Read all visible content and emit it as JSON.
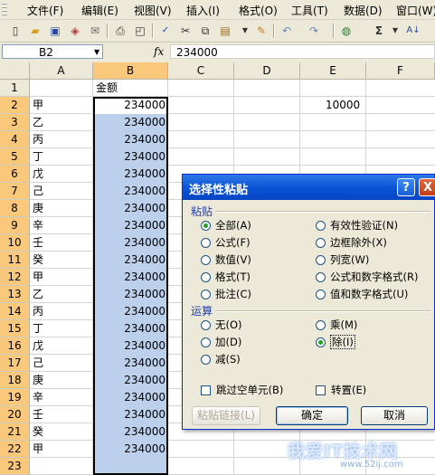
{
  "menubar": {
    "items": [
      "文件(F)",
      "编辑(E)",
      "视图(V)",
      "插入(I)",
      "格式(O)",
      "工具(T)",
      "数据(D)",
      "窗口(W)"
    ]
  },
  "toolbar": {
    "icons": [
      "new-icon",
      "open-icon",
      "save-icon",
      "permission-icon",
      "email-icon",
      "print-icon",
      "print-preview-icon",
      "spelling-icon",
      "cut-icon",
      "copy-icon",
      "paste-icon",
      "format-painter-icon",
      "undo-icon",
      "redo-icon",
      "hyperlink-icon",
      "autosum-icon",
      "sort-icon"
    ]
  },
  "formula_bar": {
    "name_box": "B2",
    "fx": "fx",
    "value": "234000"
  },
  "sheet": {
    "columns": [
      "A",
      "B",
      "C",
      "D",
      "E",
      "F"
    ],
    "rows": [
      "1",
      "2",
      "3",
      "4",
      "5",
      "6",
      "7",
      "8",
      "9",
      "10",
      "11",
      "12",
      "13",
      "14",
      "15",
      "16",
      "17",
      "18",
      "19",
      "20",
      "21",
      "22",
      "23"
    ],
    "header_b1": "金额",
    "col_a": [
      "甲",
      "乙",
      "丙",
      "丁",
      "戊",
      "己",
      "庚",
      "辛",
      "壬",
      "癸",
      "甲",
      "乙",
      "丙",
      "丁",
      "戊",
      "己",
      "庚",
      "辛",
      "壬",
      "癸",
      "甲"
    ],
    "col_b": [
      "234000",
      "234000",
      "234000",
      "234000",
      "234000",
      "234000",
      "234000",
      "234000",
      "234000",
      "234000",
      "234000",
      "234000",
      "234000",
      "234000",
      "234000",
      "234000",
      "234000",
      "234000",
      "234000",
      "234000",
      "234000"
    ],
    "e2": "10000",
    "selection_color": "#bcd0ec"
  },
  "dialog": {
    "title": "选择性粘贴",
    "help": "?",
    "close": "X",
    "paste_group": "粘贴",
    "paste_left": [
      "全部(A)",
      "公式(F)",
      "数值(V)",
      "格式(T)",
      "批注(C)"
    ],
    "paste_right": [
      "有效性验证(N)",
      "边框除外(X)",
      "列宽(W)",
      "公式和数字格式(R)",
      "值和数字格式(U)"
    ],
    "operation_group": "运算",
    "op_left": [
      "无(O)",
      "加(D)",
      "减(S)"
    ],
    "op_right": [
      "乘(M)",
      "除(I)"
    ],
    "skip_blanks": "跳过空单元(B)",
    "transpose": "转置(E)",
    "paste_link": "粘贴链接(L)",
    "ok": "确定",
    "cancel": "取消"
  },
  "watermark": {
    "text": "我爱IT技术网",
    "url": "www.52ij.com"
  }
}
